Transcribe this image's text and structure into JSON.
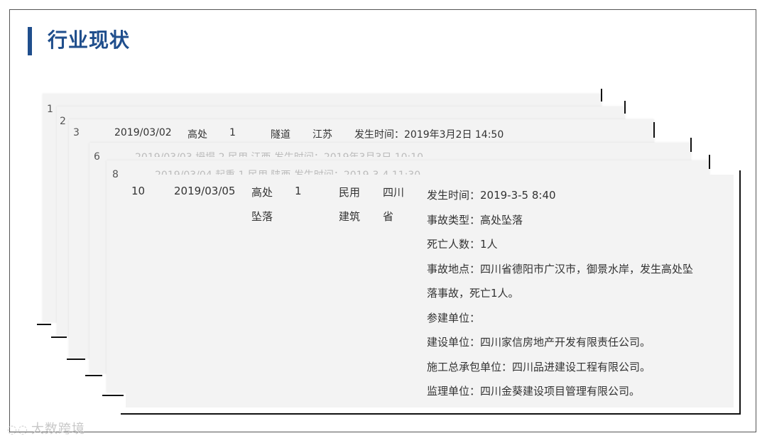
{
  "title": "行业现状",
  "stack_numbers": [
    "1",
    "2",
    "3",
    "6",
    "8"
  ],
  "card3": {
    "date": "2019/03/02",
    "type": "高处",
    "deaths": "1",
    "category": "隧道",
    "province": "江苏",
    "time": "发生时间：2019年3月2日 14:50"
  },
  "card6_faded": "2019/03/03      坍塌      2         民用      江西      发生时间：2019年3月3日 10:10",
  "card8_faded": "2019/03/04      起重      1         民用      陕西      发生时间：2019-3-4 11:30",
  "front": {
    "num": "10",
    "date": "2019/03/05",
    "type_line1": "高处",
    "type_line2": "坠落",
    "deaths": "1",
    "category_line1": "民用",
    "category_line2": "建筑",
    "province_line1": "四川",
    "province_line2": "省",
    "details": [
      "发生时间：2019-3-5 8:40",
      "事故类型：高处坠落",
      "死亡人数：1人",
      "事故地点：四川省德阳市广汉市，御景水岸，发生高处坠",
      "落事故，死亡1人。",
      "参建单位：",
      "建设单位：四川家信房地产开发有限责任公司。",
      "施工总承包单位：四川品进建设工程有限公司。",
      "监理单位：四川金葵建设项目管理有限公司。"
    ]
  },
  "watermark": "大数跨境"
}
